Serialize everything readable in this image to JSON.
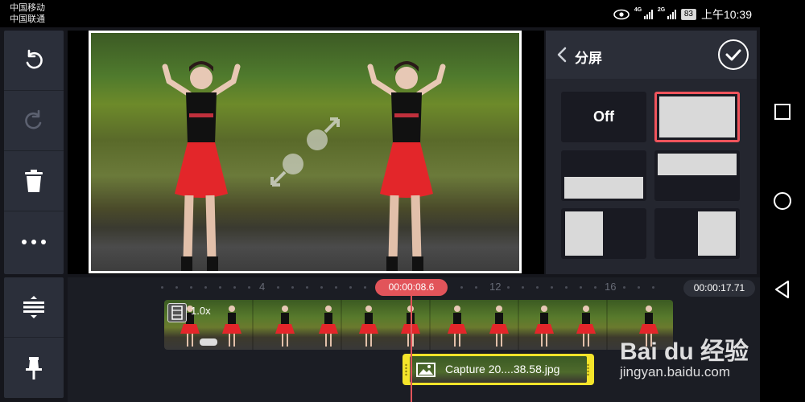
{
  "status_bar": {
    "carrier_1": "中国移动",
    "carrier_2": "中国联通",
    "network_1": "4G",
    "network_2": "2G",
    "battery": "83",
    "time": "上午10:39"
  },
  "toolbar": {
    "undo": "undo-icon",
    "redo": "redo-icon",
    "delete": "trash-icon",
    "more": "more-icon",
    "split": "split-clip-icon",
    "pin": "pin-icon"
  },
  "panel": {
    "title": "分屏",
    "options": [
      {
        "label": "Off"
      },
      {
        "label": ""
      },
      {
        "label": ""
      },
      {
        "label": ""
      },
      {
        "label": ""
      },
      {
        "label": ""
      }
    ],
    "selected_index": 1
  },
  "timeline": {
    "ruler_labels": [
      "4",
      "12",
      "16"
    ],
    "playhead_time": "00:00:08.6",
    "total_time": "00:00:17.71",
    "video_clip": {
      "speed": "1.0x"
    },
    "image_clip": {
      "filename": "Capture 20....38.58.jpg"
    }
  },
  "watermark": {
    "logo": "Bai du 经验",
    "url": "jingyan.baidu.com"
  },
  "colors": {
    "accent": "#e2545a",
    "clip_border": "#f4e42a",
    "panel_bg": "#24262f",
    "toolbar_bg": "#2b2f3a"
  }
}
